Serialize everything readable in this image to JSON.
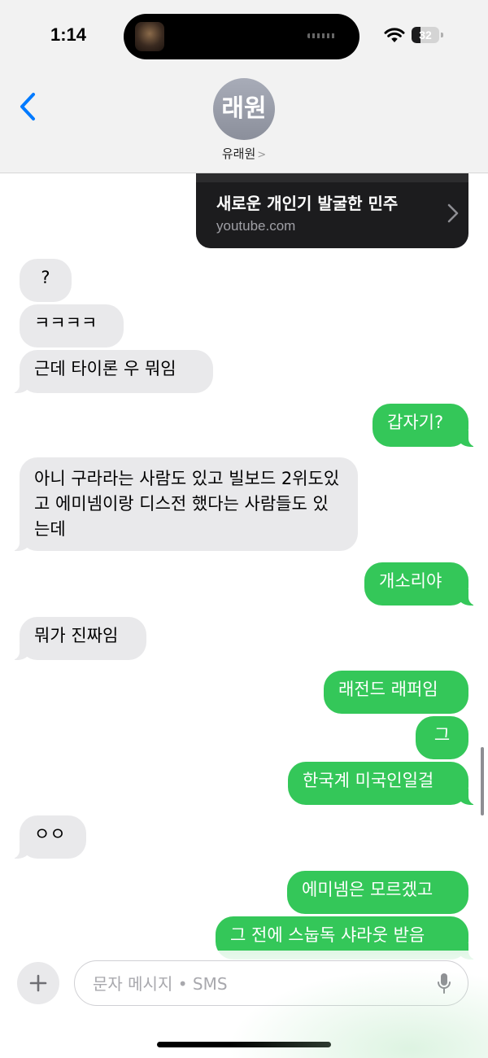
{
  "status_bar": {
    "time": "1:14",
    "battery": "32"
  },
  "header": {
    "avatar_text": "래원",
    "contact_name": "유래원",
    "contact_chevron": ">"
  },
  "link_preview": {
    "title": "새로운 개인기 발굴한 민주",
    "domain": "youtube.com"
  },
  "messages": [
    {
      "from": "them",
      "text": "?"
    },
    {
      "from": "them",
      "text": "ㅋㅋㅋㅋ"
    },
    {
      "from": "them",
      "text": "근데 타이론 우 뭐임"
    },
    {
      "from": "me",
      "text": "갑자기?"
    },
    {
      "from": "them",
      "text": "아니 구라라는 사람도 있고 빌보드 2위도있고 에미넴이랑 디스전 했다는 사람들도 있는데"
    },
    {
      "from": "me",
      "text": "개소리야"
    },
    {
      "from": "them",
      "text": "뭐가 진짜임"
    },
    {
      "from": "me",
      "text": "래전드 래퍼임"
    },
    {
      "from": "me",
      "text": "그"
    },
    {
      "from": "me",
      "text": "한국계 미국인일걸"
    },
    {
      "from": "them",
      "text": "ㅇㅇ"
    },
    {
      "from": "me",
      "text": "에미넴은 모르겠고"
    },
    {
      "from": "me",
      "text": "그 전에 스눕독 샤라웃 받음"
    }
  ],
  "input": {
    "placeholder": "문자 메시지 • SMS"
  },
  "colors": {
    "outgoing": "#34c759",
    "incoming": "#e9e9eb",
    "accent": "#007aff"
  },
  "icons": [
    "back-chevron-icon",
    "wifi-icon",
    "battery-icon",
    "plus-icon",
    "mic-icon",
    "chevron-right-icon"
  ]
}
